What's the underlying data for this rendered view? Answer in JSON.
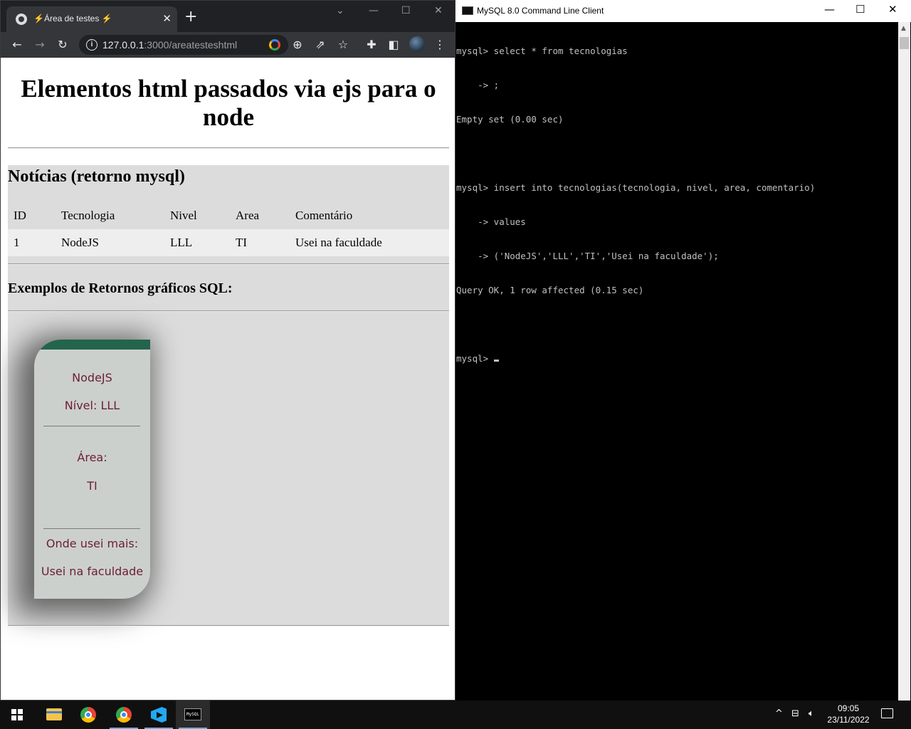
{
  "browser": {
    "tab_title": "⚡Área de testes ⚡",
    "tab_close": "✕",
    "new_tab": "+",
    "url_host": "127.0.0.1",
    "url_path": ":3000/areatesteshtml"
  },
  "page": {
    "heading": "Elementos html passados via ejs para o node",
    "news_title": "Notícias (retorno mysql)",
    "table": {
      "headers": [
        "ID",
        "Tecnologia",
        "Nivel",
        "Area",
        "Comentário"
      ],
      "rows": [
        [
          "1",
          "NodeJS",
          "LLL",
          "TI",
          "Usei na faculdade"
        ]
      ]
    },
    "examples_title": "Exemplos de Retornos gráficos SQL:",
    "card": {
      "tech": "NodeJS",
      "level": "Nível: LLL",
      "area_label": "Área:",
      "area_value": "TI",
      "where_label": "Onde usei mais:",
      "where_value": "Usei na faculdade"
    }
  },
  "mysql_window": {
    "title": "MySQL 8.0 Command Line Client",
    "lines": [
      "mysql> select * from tecnologias",
      "    -> ;",
      "Empty set (0.00 sec)",
      "",
      "mysql> insert into tecnologias(tecnologia, nivel, area, comentario)",
      "    -> values",
      "    -> ('NodeJS','LLL','TI','Usei na faculdade');",
      "Query OK, 1 row affected (0.15 sec)",
      "",
      "mysql> "
    ]
  },
  "taskbar": {
    "time": "09:05",
    "date": "23/11/2022",
    "mysql_icon_text": "MySQL"
  }
}
